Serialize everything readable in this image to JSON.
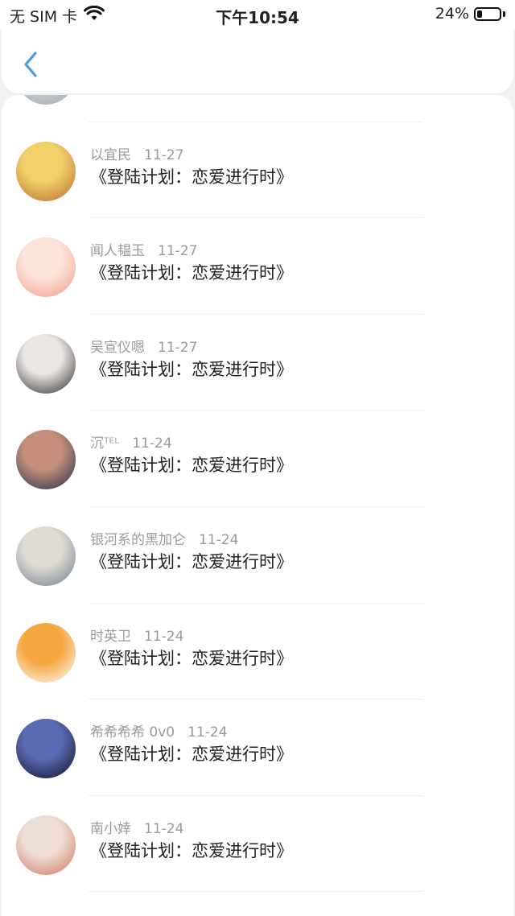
{
  "status_bar": {
    "carrier": "无 SIM 卡",
    "time": "下午10:54",
    "battery": "24%",
    "battery_level": 0.24
  },
  "nav": {
    "back_icon": "chevron-left-icon"
  },
  "list": [
    {
      "name": "",
      "date": "",
      "message": "《登陆计划：恋爱进行时》",
      "avatar_colors": [
        "#c9cdd2",
        "#8f979f"
      ]
    },
    {
      "name": "以宜民",
      "date": "11-27",
      "message": "《登陆计划：恋爱进行时》",
      "avatar_colors": [
        "#f1d06a",
        "#b86a2e"
      ]
    },
    {
      "name": "闻人韫玉",
      "date": "11-27",
      "message": "《登陆计划：恋爱进行时》",
      "avatar_colors": [
        "#fde4da",
        "#f19a8b"
      ]
    },
    {
      "name": "吴宣仪嗯",
      "date": "11-27",
      "message": "《登陆计划：恋爱进行时》",
      "avatar_colors": [
        "#e9e6e4",
        "#2a2525"
      ]
    },
    {
      "name": "沉ᵀᴱᴸ",
      "date": "11-24",
      "message": "《登陆计划：恋爱进行时》",
      "avatar_colors": [
        "#c48f7c",
        "#1f2c47"
      ]
    },
    {
      "name": "银河系的黑加仑",
      "date": "11-24",
      "message": "《登陆计划：恋爱进行时》",
      "avatar_colors": [
        "#e0dcd4",
        "#6b7a8c"
      ]
    },
    {
      "name": "时英卫",
      "date": "11-24",
      "message": "《登陆计划：恋爱进行时》",
      "avatar_colors": [
        "#f4a640",
        "#ffffff"
      ]
    },
    {
      "name": "希希希希 0v0",
      "date": "11-24",
      "message": "《登陆计划：恋爱进行时》",
      "avatar_colors": [
        "#5b6bb3",
        "#0c1024"
      ]
    },
    {
      "name": "南小婞",
      "date": "11-24",
      "message": "《登陆计划：恋爱进行时》",
      "avatar_colors": [
        "#eedfd6",
        "#d0735a"
      ]
    }
  ]
}
